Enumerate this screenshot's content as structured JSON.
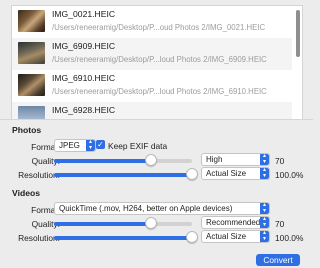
{
  "files": [
    {
      "name": "IMG_0021.HEIC",
      "path": "/Users/reneeramig/Desktop/P...oud Photos 2/IMG_0021.HEIC"
    },
    {
      "name": "IMG_6909.HEIC",
      "path": "/Users/reneeramig/Desktop/P...loud Photos 2/IMG_6909.HEIC"
    },
    {
      "name": "IMG_6910.HEIC",
      "path": "/Users/reneeramig/Desktop/P...loud Photos 2/IMG_6910.HEIC"
    },
    {
      "name": "IMG_6928.HEIC",
      "path": ""
    }
  ],
  "photos": {
    "title": "Photos",
    "format_label": "Format:",
    "format_value": "JPEG",
    "keep_exif_label": "Keep EXIF data",
    "quality_label": "Quality:",
    "quality_preset": "High",
    "quality_value": "70",
    "quality_level": 0.7,
    "resolution_label": "Resolution:",
    "resolution_preset": "Actual Size",
    "resolution_value": "100.0%",
    "resolution_level": 1.0
  },
  "videos": {
    "title": "Videos",
    "format_label": "Format:",
    "format_value": "QuickTime (.mov, H264, better on Apple devices)",
    "quality_label": "Quality:",
    "quality_preset": "Recommended",
    "quality_value": "70",
    "quality_level": 0.7,
    "resolution_label": "Resolution:",
    "resolution_preset": "Actual Size",
    "resolution_value": "100.0%",
    "resolution_level": 1.0
  },
  "convert_label": "Convert",
  "colors": {
    "accent": "#2f6fe6",
    "background": "#ececec"
  },
  "icons": {
    "checkmark": "checkmark-icon",
    "popup": "chevron-updown-icon"
  }
}
